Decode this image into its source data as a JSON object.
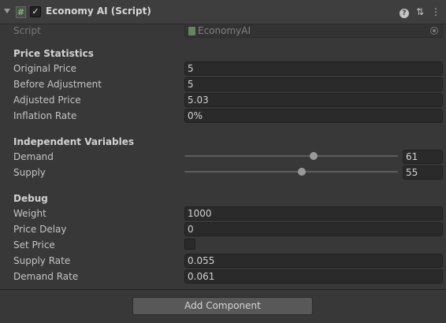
{
  "component": {
    "title": "Economy AI (Script)",
    "enabled": true,
    "icon": "csharp-script-icon",
    "script_icon_glyph": "#",
    "check_glyph": "✓",
    "help_glyph": "?",
    "preset_glyph": "⇅",
    "menu_glyph": "⋮"
  },
  "script": {
    "label": "Script",
    "value": "EconomyAI"
  },
  "price_statistics": {
    "heading": "Price Statistics",
    "fields": [
      {
        "label": "Original Price",
        "value": "5"
      },
      {
        "label": "Before Adjustment",
        "value": "5"
      },
      {
        "label": "Adjusted Price",
        "value": "5.03"
      },
      {
        "label": "Inflation Rate",
        "value": "0%"
      }
    ]
  },
  "independent_variables": {
    "heading": "Independent Variables",
    "sliders": [
      {
        "label": "Demand",
        "value": "61",
        "fraction": 0.605
      },
      {
        "label": "Supply",
        "value": "55",
        "fraction": 0.549
      }
    ]
  },
  "debug": {
    "heading": "Debug",
    "weight": {
      "label": "Weight",
      "value": "1000"
    },
    "price_delay": {
      "label": "Price Delay",
      "value": "0"
    },
    "set_price": {
      "label": "Set Price",
      "checked": false
    },
    "supply_rate": {
      "label": "Supply Rate",
      "value": "0.055"
    },
    "demand_rate": {
      "label": "Demand Rate",
      "value": "0.061"
    }
  },
  "add_component": {
    "label": "Add Component"
  },
  "colors": {
    "background": "#383838",
    "header": "#3e3e3e",
    "field": "#2a2a2a",
    "button": "#585858",
    "script_icon_accent": "#79c16d"
  }
}
